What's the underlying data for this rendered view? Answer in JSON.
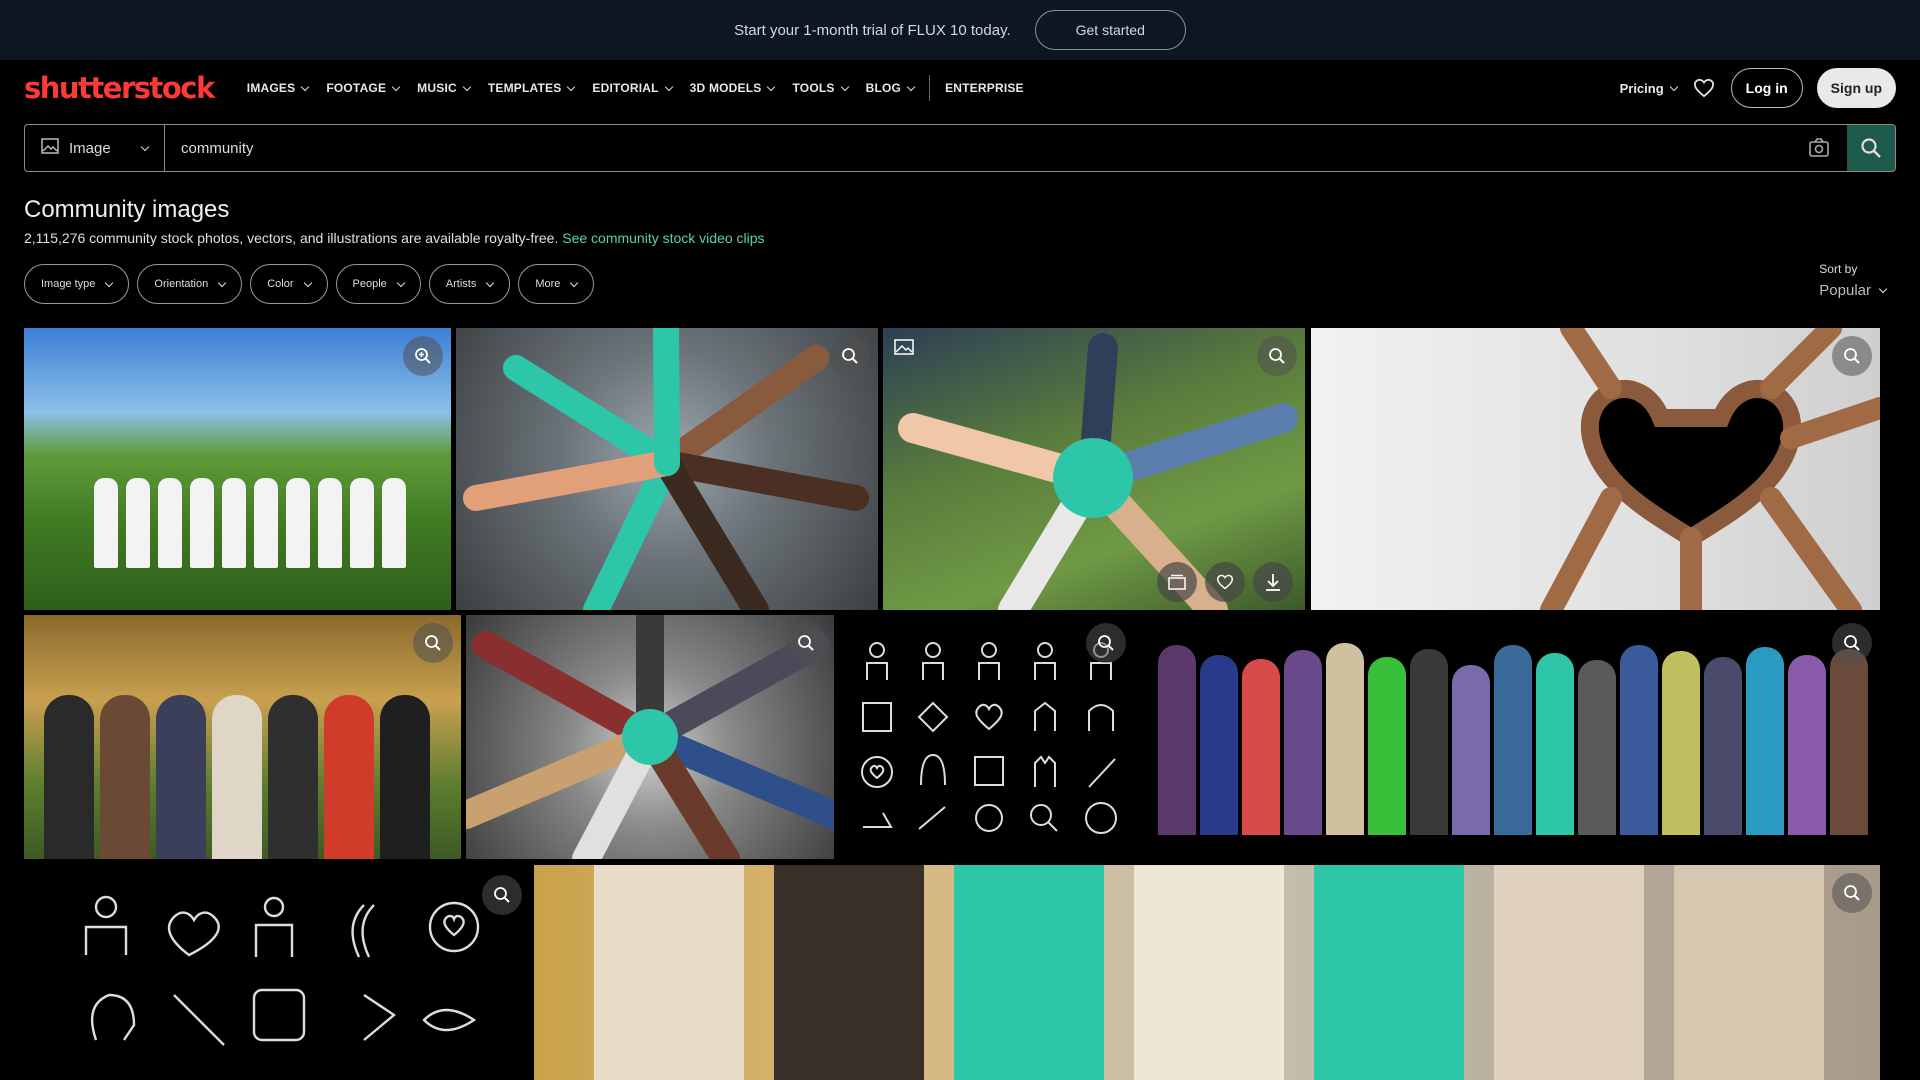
{
  "promo": {
    "text": "Start your 1-month trial of FLUX 10 today.",
    "cta": "Get started"
  },
  "nav": {
    "logo": "shutterstock",
    "items": [
      {
        "label": "IMAGES"
      },
      {
        "label": "FOOTAGE"
      },
      {
        "label": "MUSIC"
      },
      {
        "label": "TEMPLATES"
      },
      {
        "label": "EDITORIAL"
      },
      {
        "label": "3D MODELS"
      },
      {
        "label": "TOOLS"
      },
      {
        "label": "BLOG"
      }
    ],
    "enterprise": "ENTERPRISE",
    "pricing": "Pricing",
    "login": "Log in",
    "signup": "Sign up"
  },
  "search": {
    "type_label": "Image",
    "query": "community"
  },
  "results": {
    "title": "Community images",
    "subtitle": "2,115,276 community stock photos, vectors, and illustrations are available royalty-free.",
    "link": "See community stock video clips"
  },
  "filters": [
    {
      "label": "Image type"
    },
    {
      "label": "Orientation"
    },
    {
      "label": "Color"
    },
    {
      "label": "People"
    },
    {
      "label": "Artists"
    },
    {
      "label": "More"
    }
  ],
  "sort": {
    "label": "Sort by",
    "value": "Popular"
  },
  "colors": {
    "brand": "#fc3b36",
    "link": "#5ad0b6",
    "banner": "#0d1623",
    "search_button": "#1e5a4c"
  }
}
